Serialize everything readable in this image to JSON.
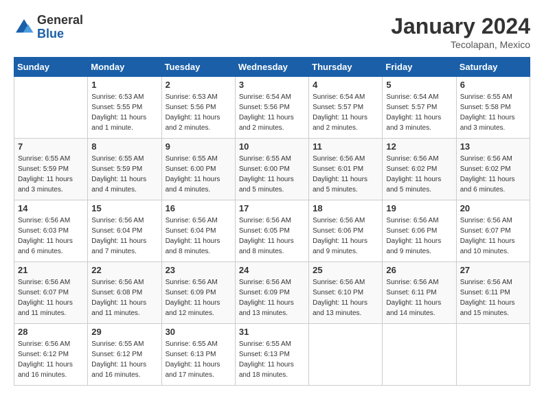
{
  "logo": {
    "general": "General",
    "blue": "Blue"
  },
  "title": "January 2024",
  "location": "Tecolapan, Mexico",
  "days_of_week": [
    "Sunday",
    "Monday",
    "Tuesday",
    "Wednesday",
    "Thursday",
    "Friday",
    "Saturday"
  ],
  "weeks": [
    [
      {
        "day": "",
        "sunrise": "",
        "sunset": "",
        "daylight": ""
      },
      {
        "day": "1",
        "sunrise": "Sunrise: 6:53 AM",
        "sunset": "Sunset: 5:55 PM",
        "daylight": "Daylight: 11 hours and 1 minute."
      },
      {
        "day": "2",
        "sunrise": "Sunrise: 6:53 AM",
        "sunset": "Sunset: 5:56 PM",
        "daylight": "Daylight: 11 hours and 2 minutes."
      },
      {
        "day": "3",
        "sunrise": "Sunrise: 6:54 AM",
        "sunset": "Sunset: 5:56 PM",
        "daylight": "Daylight: 11 hours and 2 minutes."
      },
      {
        "day": "4",
        "sunrise": "Sunrise: 6:54 AM",
        "sunset": "Sunset: 5:57 PM",
        "daylight": "Daylight: 11 hours and 2 minutes."
      },
      {
        "day": "5",
        "sunrise": "Sunrise: 6:54 AM",
        "sunset": "Sunset: 5:57 PM",
        "daylight": "Daylight: 11 hours and 3 minutes."
      },
      {
        "day": "6",
        "sunrise": "Sunrise: 6:55 AM",
        "sunset": "Sunset: 5:58 PM",
        "daylight": "Daylight: 11 hours and 3 minutes."
      }
    ],
    [
      {
        "day": "7",
        "sunrise": "Sunrise: 6:55 AM",
        "sunset": "Sunset: 5:59 PM",
        "daylight": "Daylight: 11 hours and 3 minutes."
      },
      {
        "day": "8",
        "sunrise": "Sunrise: 6:55 AM",
        "sunset": "Sunset: 5:59 PM",
        "daylight": "Daylight: 11 hours and 4 minutes."
      },
      {
        "day": "9",
        "sunrise": "Sunrise: 6:55 AM",
        "sunset": "Sunset: 6:00 PM",
        "daylight": "Daylight: 11 hours and 4 minutes."
      },
      {
        "day": "10",
        "sunrise": "Sunrise: 6:55 AM",
        "sunset": "Sunset: 6:00 PM",
        "daylight": "Daylight: 11 hours and 5 minutes."
      },
      {
        "day": "11",
        "sunrise": "Sunrise: 6:56 AM",
        "sunset": "Sunset: 6:01 PM",
        "daylight": "Daylight: 11 hours and 5 minutes."
      },
      {
        "day": "12",
        "sunrise": "Sunrise: 6:56 AM",
        "sunset": "Sunset: 6:02 PM",
        "daylight": "Daylight: 11 hours and 5 minutes."
      },
      {
        "day": "13",
        "sunrise": "Sunrise: 6:56 AM",
        "sunset": "Sunset: 6:02 PM",
        "daylight": "Daylight: 11 hours and 6 minutes."
      }
    ],
    [
      {
        "day": "14",
        "sunrise": "Sunrise: 6:56 AM",
        "sunset": "Sunset: 6:03 PM",
        "daylight": "Daylight: 11 hours and 6 minutes."
      },
      {
        "day": "15",
        "sunrise": "Sunrise: 6:56 AM",
        "sunset": "Sunset: 6:04 PM",
        "daylight": "Daylight: 11 hours and 7 minutes."
      },
      {
        "day": "16",
        "sunrise": "Sunrise: 6:56 AM",
        "sunset": "Sunset: 6:04 PM",
        "daylight": "Daylight: 11 hours and 8 minutes."
      },
      {
        "day": "17",
        "sunrise": "Sunrise: 6:56 AM",
        "sunset": "Sunset: 6:05 PM",
        "daylight": "Daylight: 11 hours and 8 minutes."
      },
      {
        "day": "18",
        "sunrise": "Sunrise: 6:56 AM",
        "sunset": "Sunset: 6:06 PM",
        "daylight": "Daylight: 11 hours and 9 minutes."
      },
      {
        "day": "19",
        "sunrise": "Sunrise: 6:56 AM",
        "sunset": "Sunset: 6:06 PM",
        "daylight": "Daylight: 11 hours and 9 minutes."
      },
      {
        "day": "20",
        "sunrise": "Sunrise: 6:56 AM",
        "sunset": "Sunset: 6:07 PM",
        "daylight": "Daylight: 11 hours and 10 minutes."
      }
    ],
    [
      {
        "day": "21",
        "sunrise": "Sunrise: 6:56 AM",
        "sunset": "Sunset: 6:07 PM",
        "daylight": "Daylight: 11 hours and 11 minutes."
      },
      {
        "day": "22",
        "sunrise": "Sunrise: 6:56 AM",
        "sunset": "Sunset: 6:08 PM",
        "daylight": "Daylight: 11 hours and 11 minutes."
      },
      {
        "day": "23",
        "sunrise": "Sunrise: 6:56 AM",
        "sunset": "Sunset: 6:09 PM",
        "daylight": "Daylight: 11 hours and 12 minutes."
      },
      {
        "day": "24",
        "sunrise": "Sunrise: 6:56 AM",
        "sunset": "Sunset: 6:09 PM",
        "daylight": "Daylight: 11 hours and 13 minutes."
      },
      {
        "day": "25",
        "sunrise": "Sunrise: 6:56 AM",
        "sunset": "Sunset: 6:10 PM",
        "daylight": "Daylight: 11 hours and 13 minutes."
      },
      {
        "day": "26",
        "sunrise": "Sunrise: 6:56 AM",
        "sunset": "Sunset: 6:11 PM",
        "daylight": "Daylight: 11 hours and 14 minutes."
      },
      {
        "day": "27",
        "sunrise": "Sunrise: 6:56 AM",
        "sunset": "Sunset: 6:11 PM",
        "daylight": "Daylight: 11 hours and 15 minutes."
      }
    ],
    [
      {
        "day": "28",
        "sunrise": "Sunrise: 6:56 AM",
        "sunset": "Sunset: 6:12 PM",
        "daylight": "Daylight: 11 hours and 16 minutes."
      },
      {
        "day": "29",
        "sunrise": "Sunrise: 6:55 AM",
        "sunset": "Sunset: 6:12 PM",
        "daylight": "Daylight: 11 hours and 16 minutes."
      },
      {
        "day": "30",
        "sunrise": "Sunrise: 6:55 AM",
        "sunset": "Sunset: 6:13 PM",
        "daylight": "Daylight: 11 hours and 17 minutes."
      },
      {
        "day": "31",
        "sunrise": "Sunrise: 6:55 AM",
        "sunset": "Sunset: 6:13 PM",
        "daylight": "Daylight: 11 hours and 18 minutes."
      },
      {
        "day": "",
        "sunrise": "",
        "sunset": "",
        "daylight": ""
      },
      {
        "day": "",
        "sunrise": "",
        "sunset": "",
        "daylight": ""
      },
      {
        "day": "",
        "sunrise": "",
        "sunset": "",
        "daylight": ""
      }
    ]
  ]
}
